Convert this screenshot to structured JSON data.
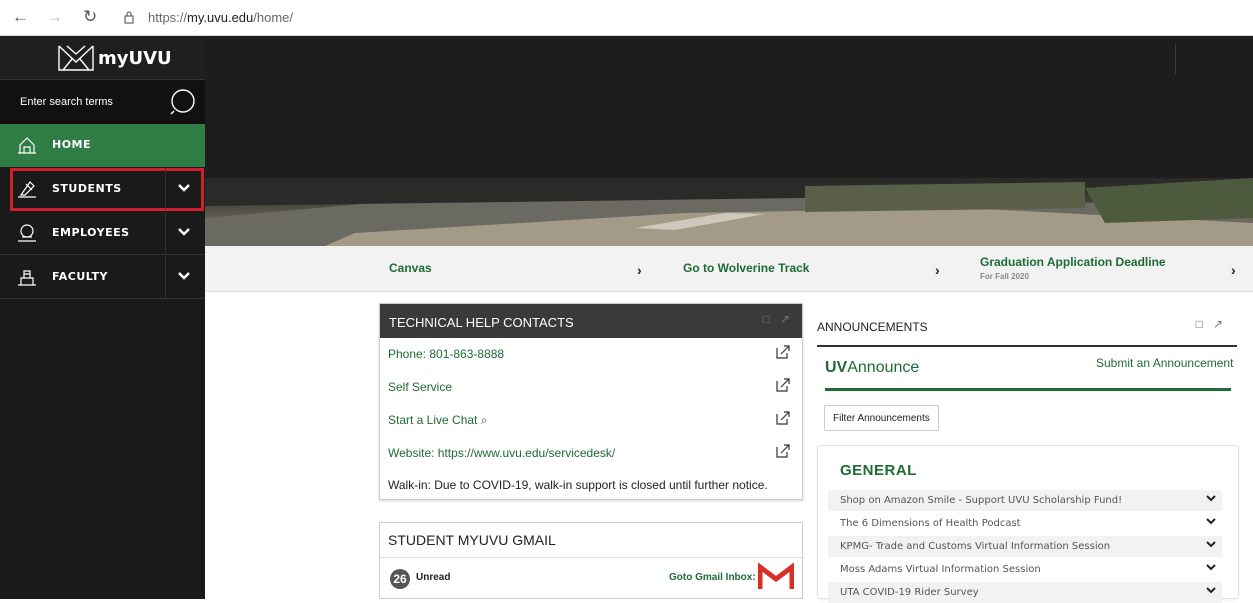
{
  "browser": {
    "url_prefix": "https://",
    "url_host": "my.uvu.edu",
    "url_path": "/home/",
    "back": "←",
    "forward": "→",
    "reload": "↻"
  },
  "sidebar": {
    "logo_text": "myUVU",
    "search_placeholder": "Enter search terms",
    "items": [
      {
        "label": "HOME"
      },
      {
        "label": "STUDENTS"
      },
      {
        "label": "EMPLOYEES"
      },
      {
        "label": "FACULTY"
      }
    ]
  },
  "colors": {
    "accent": "#1e6b35",
    "highlight": "#d11f2e"
  },
  "quick_links": [
    {
      "label": "Canvas",
      "arrow": "›"
    },
    {
      "label": "Go to Wolverine Track",
      "arrow": "›"
    },
    {
      "label": "Graduation Application Deadline",
      "sub": "For Fall 2020",
      "arrow": "›"
    }
  ],
  "tech_help": {
    "title": "TECHNICAL HELP CONTACTS",
    "lines": [
      {
        "text": "Phone: 801-863-8888"
      },
      {
        "text": "Self Service"
      },
      {
        "text": "Start a Live Chat ⌕"
      },
      {
        "text": "Website: https://www.uvu.edu/servicedesk/"
      }
    ],
    "walkin": "Walk-in: Due to COVID-19, walk-in support is closed until further notice."
  },
  "gmail": {
    "title": "STUDENT MYUVU GMAIL",
    "count": "26",
    "unread_label": "Unread",
    "goto_label": "Goto Gmail Inbox:"
  },
  "announcements": {
    "title": "ANNOUNCEMENTS",
    "uv_bold": "UV",
    "uv_rest": "Announce",
    "submit": "Submit an Announcement",
    "filter": "Filter Announcements",
    "section": "GENERAL",
    "items": [
      "Shop on Amazon Smile - Support UVU Scholarship Fund!",
      "The 6 Dimensions of Health Podcast",
      "KPMG- Trade and Customs Virtual Information Session",
      "Moss Adams Virtual Information Session",
      "UTA COVID-19 Rider Survey"
    ]
  }
}
